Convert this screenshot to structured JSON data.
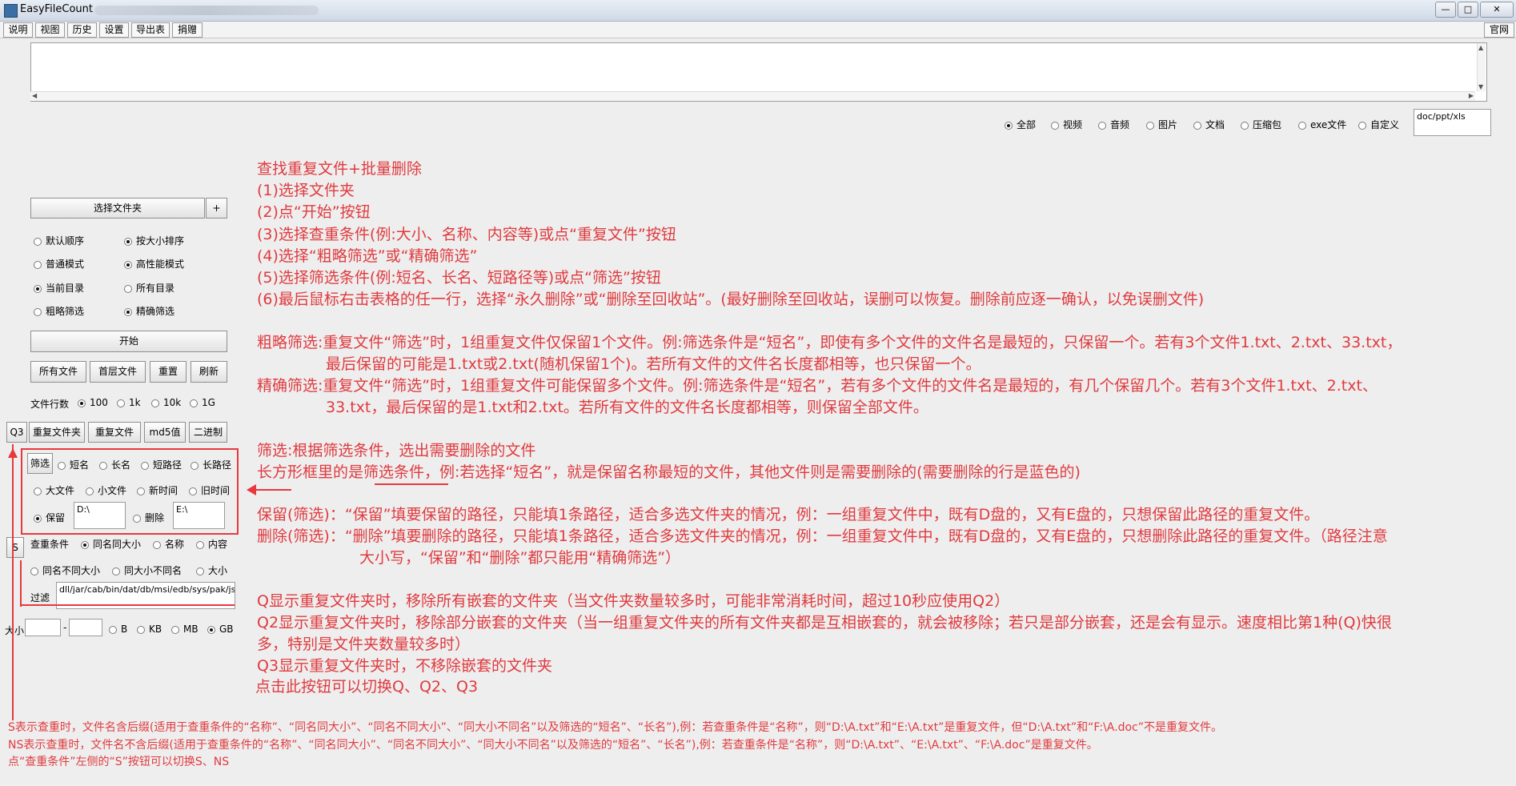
{
  "window": {
    "title": "EasyFileCount",
    "min": "—",
    "max": "□",
    "close": "✕"
  },
  "menu": {
    "items": [
      "说明",
      "视图",
      "历史",
      "设置",
      "导出表",
      "捐赠"
    ],
    "right": "官网"
  },
  "filter_types": {
    "items": [
      {
        "label": "全部",
        "checked": true
      },
      {
        "label": "视频",
        "checked": false
      },
      {
        "label": "音频",
        "checked": false
      },
      {
        "label": "图片",
        "checked": false
      },
      {
        "label": "文档",
        "checked": false
      },
      {
        "label": "压缩包",
        "checked": false
      },
      {
        "label": "exe文件",
        "checked": false
      },
      {
        "label": "自定义",
        "checked": false
      }
    ],
    "custom_value": "doc/ppt/xls"
  },
  "left": {
    "choose_folder": "选择文件夹",
    "plus": "+",
    "sort": [
      "默认顺序",
      "按大小排序"
    ],
    "mode": [
      "普通模式",
      "高性能模式"
    ],
    "scope": [
      "当前目录",
      "所有目录"
    ],
    "screen": [
      "粗略筛选",
      "精确筛选"
    ],
    "start": "开始",
    "buttons_row1": [
      "所有文件",
      "首层文件",
      "重置",
      "刷新"
    ],
    "lines_label": "文件行数",
    "lines_opts": [
      "100",
      "1k",
      "10k",
      "1G"
    ],
    "q_button": "Q3",
    "buttons_row2": [
      "重复文件夹",
      "重复文件",
      "md5值",
      "二进制"
    ],
    "screen_btn": "筛选",
    "screen_opts_row1": [
      "短名",
      "长名",
      "短路径",
      "长路径"
    ],
    "screen_opts_row2": [
      "大文件",
      "小文件",
      "新时间",
      "旧时间"
    ],
    "keep_label": "保留",
    "keep_value": "D:\\",
    "delete_label": "删除",
    "delete_value": "E:\\",
    "s_button": "S",
    "dup_label": "查重条件",
    "dup_opts_row1": [
      "同名同大小",
      "名称",
      "内容"
    ],
    "dup_opts_row2": [
      "同名不同大小",
      "同大小不同名",
      "大小"
    ],
    "filter_label": "过滤",
    "filter_value": "dll/jar/cab/bin/dat/db/msi/edb/sys/pak/jsa",
    "size_label": "大小",
    "size_dash": "-",
    "size_units": [
      "B",
      "KB",
      "MB",
      "GB"
    ]
  },
  "annotations": {
    "steps": [
      "查找重复文件+批量删除",
      "(1)选择文件夹",
      "(2)点“开始”按钮",
      "(3)选择查重条件(例:大小、名称、内容等)或点“重复文件”按钮",
      "(4)选择“粗略筛选”或“精确筛选”",
      "(5)选择筛选条件(例:短名、长名、短路径等)或点“筛选”按钮",
      "(6)最后鼠标右击表格的任一行，选择“永久删除”或“删除至回收站”。(最好删除至回收站，误删可以恢复。删除前应逐一确认，以免误删文件)"
    ],
    "rough": [
      "粗略筛选:重复文件“筛选”时，1组重复文件仅保留1个文件。例:筛选条件是“短名”，即使有多个文件的文件名是最短的，只保留一个。若有3个文件1.txt、2.txt、33.txt，",
      "最后保留的可能是1.txt或2.txt(随机保留1个)。若所有文件的文件名长度都相等，也只保留一个。"
    ],
    "precise": [
      "精确筛选:重复文件“筛选”时，1组重复文件可能保留多个文件。例:筛选条件是“短名”，若有多个文件的文件名是最短的，有几个保留几个。若有3个文件1.txt、2.txt、",
      "33.txt，最后保留的是1.txt和2.txt。若所有文件的文件名长度都相等，则保留全部文件。"
    ],
    "screen_desc": [
      "筛选:根据筛选条件，选出需要删除的文件",
      "长方形框里的是筛选条件，例:若选择“短名”，就是保留名称最短的文件，其他文件则是需要删除的(需要删除的行是蓝色的)"
    ],
    "keep_delete": [
      "保留(筛选)：“保留”填要保留的路径，只能填1条路径，适合多选文件夹的情况，例：一组重复文件中，既有D盘的，又有E盘的，只想保留此路径的重复文件。",
      "删除(筛选)：“删除”填要删除的路径，只能填1条路径，适合多选文件夹的情况，例：一组重复文件中，既有D盘的，又有E盘的，只想删除此路径的重复文件。（路径注意",
      "大小写，“保留”和“删除”都只能用“精确筛选”）"
    ],
    "q_desc": [
      "Q显示重复文件夹时，移除所有嵌套的文件夹（当文件夹数量较多时，可能非常消耗时间，超过10秒应使用Q2）",
      "Q2显示重复文件夹时，移除部分嵌套的文件夹（当一组重复文件夹的所有文件夹都是互相嵌套的，就会被移除；若只是部分嵌套，还是会有显示。速度相比第1种(Q)快很",
      "多，特别是文件夹数量较多时）",
      "Q3显示重复文件夹时，不移除嵌套的文件夹",
      "点击此按钮可以切换Q、Q2、Q3"
    ],
    "s_desc": [
      "S表示查重时，文件名含后缀(适用于查重条件的“名称”、“同名同大小”、“同名不同大小”、“同大小不同名”以及筛选的“短名”、“长名”),例：若查重条件是“名称”，则“D:\\A.txt”和“E:\\A.txt”是重复文件，但“D:\\A.txt”和“F:\\A.doc”不是重复文件。",
      "NS表示查重时，文件名不含后缀(适用于查重条件的“名称”、“同名同大小”、“同名不同大小”、“同大小不同名”以及筛选的“短名”、“长名”),例：若查重条件是“名称”，则“D:\\A.txt”、“E:\\A.txt”、“F:\\A.doc”是重复文件。",
      "点“查重条件”左侧的“S”按钮可以切换S、NS"
    ]
  }
}
